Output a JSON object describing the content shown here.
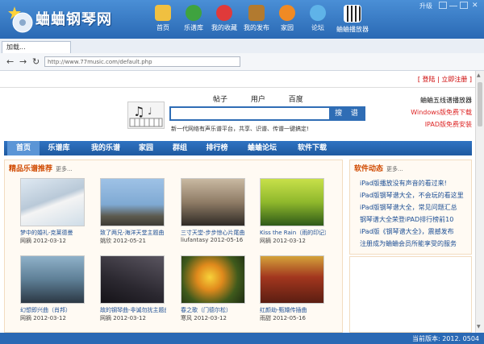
{
  "app": {
    "title": "蛐蛐钢琴网"
  },
  "nav": [
    {
      "label": "首页",
      "icon": "home-icon",
      "color": "#f0c040"
    },
    {
      "label": "乐谱库",
      "icon": "globe-search-icon",
      "color": "#3fa33f"
    },
    {
      "label": "我的收藏",
      "icon": "heart-icon",
      "color": "#e03a3a"
    },
    {
      "label": "我的发布",
      "icon": "pen-tool-icon",
      "color": "#b27a2f"
    },
    {
      "label": "家园",
      "icon": "people-icon",
      "color": "#f08a24"
    },
    {
      "label": "论坛",
      "icon": "chat-icon",
      "color": "#5fb3e8"
    },
    {
      "label": "蛐蛐播放器",
      "icon": "piano-icon",
      "color": "#222222"
    }
  ],
  "window": {
    "upgrade": "升级"
  },
  "browser": {
    "tab": "加载...",
    "url": "http://www.77music.com/default.php"
  },
  "header": {
    "login": "登陆",
    "register": "立即注册",
    "search_tabs": [
      "帖子",
      "用户",
      "百度"
    ],
    "search_button": "搜 谱",
    "slogan": "新一代网络有声乐谱平台，共享、识谱、传谱一键搞定!",
    "promo": [
      "蛐蛐五线谱播放器",
      "Windows版免费下载",
      "IPAD版免费安装"
    ]
  },
  "categories": [
    "首页",
    "乐谱库",
    "我的乐谱",
    "家园",
    "群组",
    "排行榜",
    "蛐蛐论坛",
    "软件下载"
  ],
  "featured": {
    "title": "精品乐谱推荐",
    "more": "更多...",
    "songs": [
      {
        "name": "梦中的婚礼-克莱德曼",
        "user": "网摘",
        "date": "2012-03-12"
      },
      {
        "name": "致了两兄-海洋天堂主题曲",
        "user": "姚欣",
        "date": "2012-05-21"
      },
      {
        "name": "三寸天堂-步步惊心片尾曲",
        "user": "liufantasy",
        "date": "2012-05-16"
      },
      {
        "name": "Kiss the Rain（雨的印记）",
        "user": "网摘",
        "date": "2012-03-12"
      },
      {
        "name": "幻想即兴曲（肖邦）",
        "user": "网摘",
        "date": "2012-03-12"
      },
      {
        "name": "故的钢琴曲-非诚勿扰主题曲",
        "user": "网摘",
        "date": "2012-03-12"
      },
      {
        "name": "春之歌（门德尔松）",
        "user": "寒风",
        "date": "2012-03-12"
      },
      {
        "name": "红颜劫-甄嬛传插曲",
        "user": "雨甜",
        "date": "2012-05-16"
      }
    ]
  },
  "news": {
    "title": "软件动态",
    "more": "更多...",
    "items": [
      "iPad版播放没有声音的看过来!",
      "iPad版钢琴谱大全，不会玩的看这里",
      "iPad版钢琴谱大全，常见问题汇总",
      "钢琴谱大全荣登iPAD排行榜前10",
      "iPad版《钢琴谱大全》，震撼发布",
      "注册成为蛐蛐会员所能享受的服务"
    ]
  },
  "status": {
    "version": "当前版本: 2012. 0504"
  },
  "watermark": "当下软件园"
}
